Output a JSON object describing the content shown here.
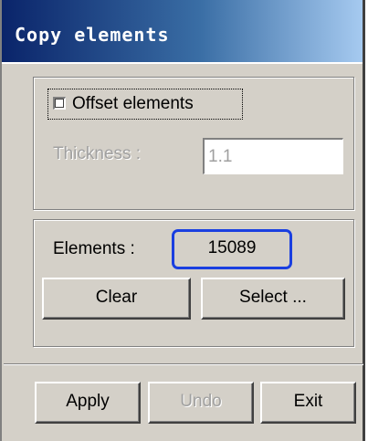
{
  "window": {
    "title": "Copy elements"
  },
  "offset_group": {
    "checkbox_label": "Offset elements",
    "checkbox_checked": false,
    "thickness_label": "Thickness :",
    "thickness_value": "1.1"
  },
  "elements_group": {
    "label": "Elements :",
    "count": "15089",
    "clear_label": "Clear",
    "select_label": "Select ..."
  },
  "footer": {
    "apply_label": "Apply",
    "undo_label": "Undo",
    "exit_label": "Exit"
  },
  "colors": {
    "dialog_bg": "#d4d0c8",
    "title_start": "#0a246a",
    "title_end": "#a6caf0",
    "highlight_border": "#1a3fe0",
    "disabled_text": "#a0a0a0"
  }
}
